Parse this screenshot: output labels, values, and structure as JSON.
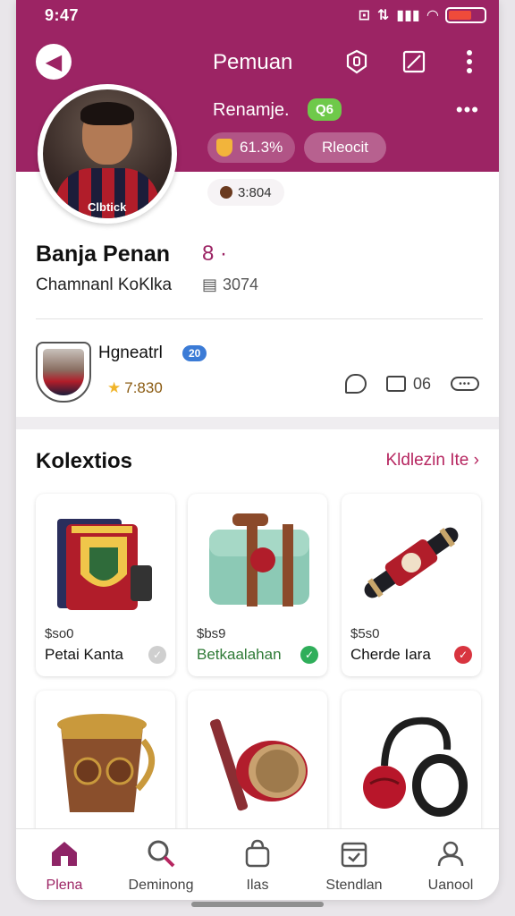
{
  "status_bar": {
    "time": "9:47",
    "icons": [
      "nfc-icon",
      "data-icon",
      "wifi-icon",
      "signal-icon",
      "battery-icon"
    ],
    "battery_level": 0.65,
    "battery_color": "#ef4b3a"
  },
  "colors": {
    "brand": "#9c2464",
    "accent_link": "#b62660",
    "badge_green": "#6fc94a",
    "badge_blue": "#3b7bd6"
  },
  "top_bar": {
    "title": "Pemuan",
    "icons": [
      "back-icon",
      "badge-icon",
      "edit-icon",
      "more-vertical-icon"
    ]
  },
  "profile": {
    "handle": "Renamje.",
    "level_badge": "Q6",
    "stat_value": "61.3%",
    "action_label": "Rleocit",
    "sub_stat": "3:804",
    "jersey_text": "Clbtick",
    "full_name": "Banja Penan",
    "name_suffix": "8 ·",
    "subtitle": "Chamnanl KoKlka",
    "subtitle_count": "3074"
  },
  "club": {
    "name": "Hgneatrl",
    "badge": "20",
    "points": "7:830",
    "action_count": "06"
  },
  "collection": {
    "title": "Kolextios",
    "link_label": "Kldlezin Ite",
    "items": [
      {
        "price": "$so0",
        "name": "Petai Kanta",
        "tag_color": "#cfcfcf"
      },
      {
        "price": "$bs9",
        "name": "Betkaalahan",
        "tag_color": "#2fae5a"
      },
      {
        "price": "$5s0",
        "name": "Cherde Iara",
        "tag_color": "#d8343f"
      },
      {
        "price": "",
        "name": "",
        "tag_color": ""
      },
      {
        "price": "",
        "name": "",
        "tag_color": ""
      },
      {
        "price": "",
        "name": "",
        "tag_color": ""
      }
    ]
  },
  "bottom_nav": {
    "items": [
      {
        "label": "Plena",
        "icon": "home-icon",
        "active": true
      },
      {
        "label": "Deminong",
        "icon": "search-icon",
        "active": false
      },
      {
        "label": "Ilas",
        "icon": "bag-icon",
        "active": false
      },
      {
        "label": "Stendlan",
        "icon": "calendar-icon",
        "active": false
      },
      {
        "label": "Uanool",
        "icon": "profile-icon",
        "active": false
      }
    ]
  }
}
